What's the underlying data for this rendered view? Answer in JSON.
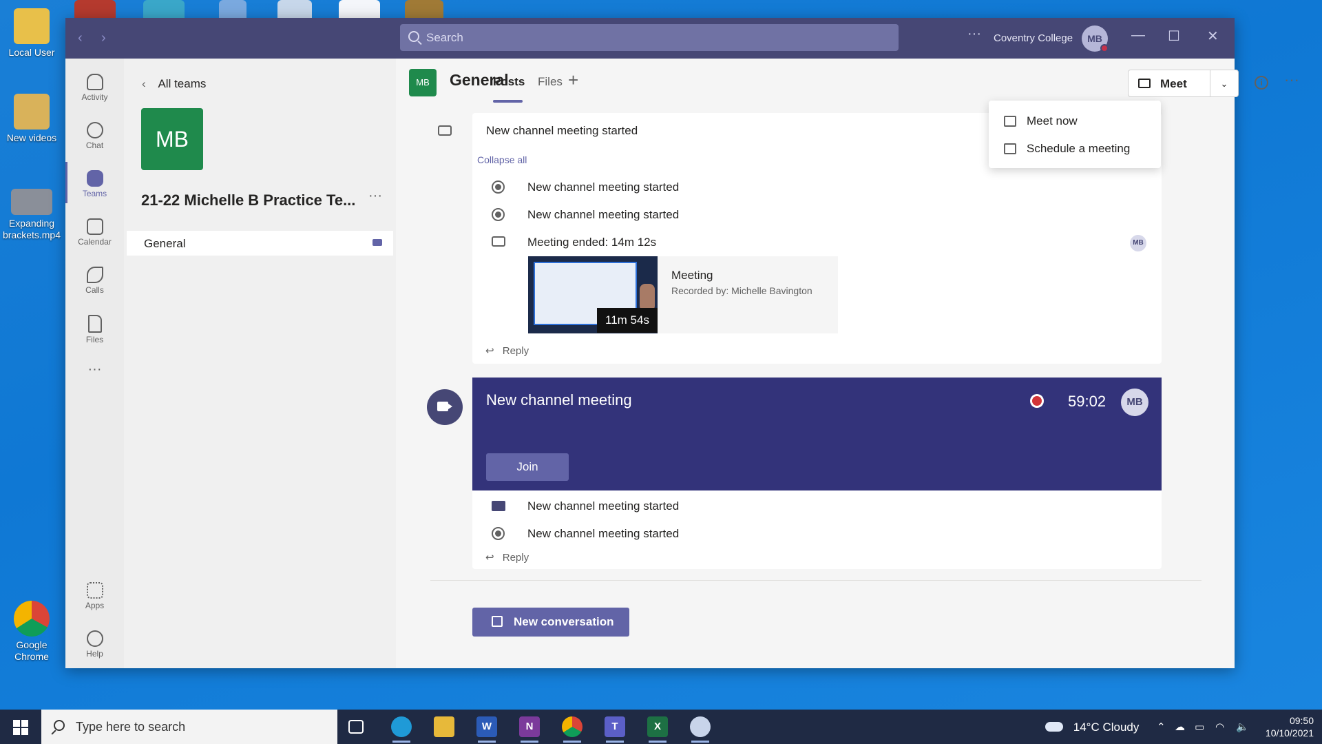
{
  "desktop": {
    "icons": [
      {
        "label": "Local User"
      },
      {
        "label": "New videos"
      },
      {
        "label": "Expanding brackets.mp4"
      },
      {
        "label": "Google Chrome"
      }
    ]
  },
  "titlebar": {
    "search_placeholder": "Search",
    "more": "···",
    "org_name": "Coventry College",
    "avatar_initials": "MB"
  },
  "rail": {
    "items": [
      {
        "label": "Activity"
      },
      {
        "label": "Chat"
      },
      {
        "label": "Teams"
      },
      {
        "label": "Calendar"
      },
      {
        "label": "Calls"
      },
      {
        "label": "Files"
      },
      {
        "label": "···"
      },
      {
        "label": "Apps"
      },
      {
        "label": "Help"
      }
    ]
  },
  "team_panel": {
    "back_label": "All teams",
    "team_initials": "MB",
    "team_name": "21-22 Michelle B Practice Te...",
    "team_more": "···",
    "channels": [
      {
        "label": "General"
      }
    ]
  },
  "channel_header": {
    "initials": "MB",
    "title": "General",
    "tabs": [
      {
        "label": "Posts"
      },
      {
        "label": "Files"
      }
    ],
    "add_tab": "+",
    "meet_label": "Meet",
    "meet_dropdown": "⌄",
    "more": "···"
  },
  "meet_menu": {
    "items": [
      {
        "label": "Meet now"
      },
      {
        "label": "Schedule a meeting"
      }
    ]
  },
  "posts": {
    "thread1": {
      "title": "New channel meeting started",
      "collapse_label": "Collapse all",
      "rows": [
        {
          "text": "New channel meeting started"
        },
        {
          "text": "New channel meeting started"
        },
        {
          "text": "Meeting ended: 14m 12s"
        }
      ],
      "recording": {
        "duration": "11m 54s",
        "title": "Meeting",
        "recorded_by": "Recorded by: Michelle Bavington"
      },
      "avatar_initials": "MB",
      "reply_label": "Reply"
    },
    "thread2": {
      "title": "New channel meeting",
      "timer": "59:02",
      "avatar_initials": "MB",
      "join_label": "Join",
      "rows": [
        {
          "text": "New channel meeting started"
        },
        {
          "text": "New channel meeting started"
        }
      ],
      "reply_label": "Reply"
    },
    "new_conversation_label": "New conversation"
  },
  "taskbar": {
    "search_placeholder": "Type here to search",
    "weather": "14°C  Cloudy",
    "time": "09:50",
    "date": "10/10/2021"
  },
  "colors": {
    "teams_purple": "#6264a7",
    "titlebar": "#464775",
    "live_banner": "#33337a",
    "team_tile": "#1f8a4c",
    "record_red": "#d13438"
  }
}
